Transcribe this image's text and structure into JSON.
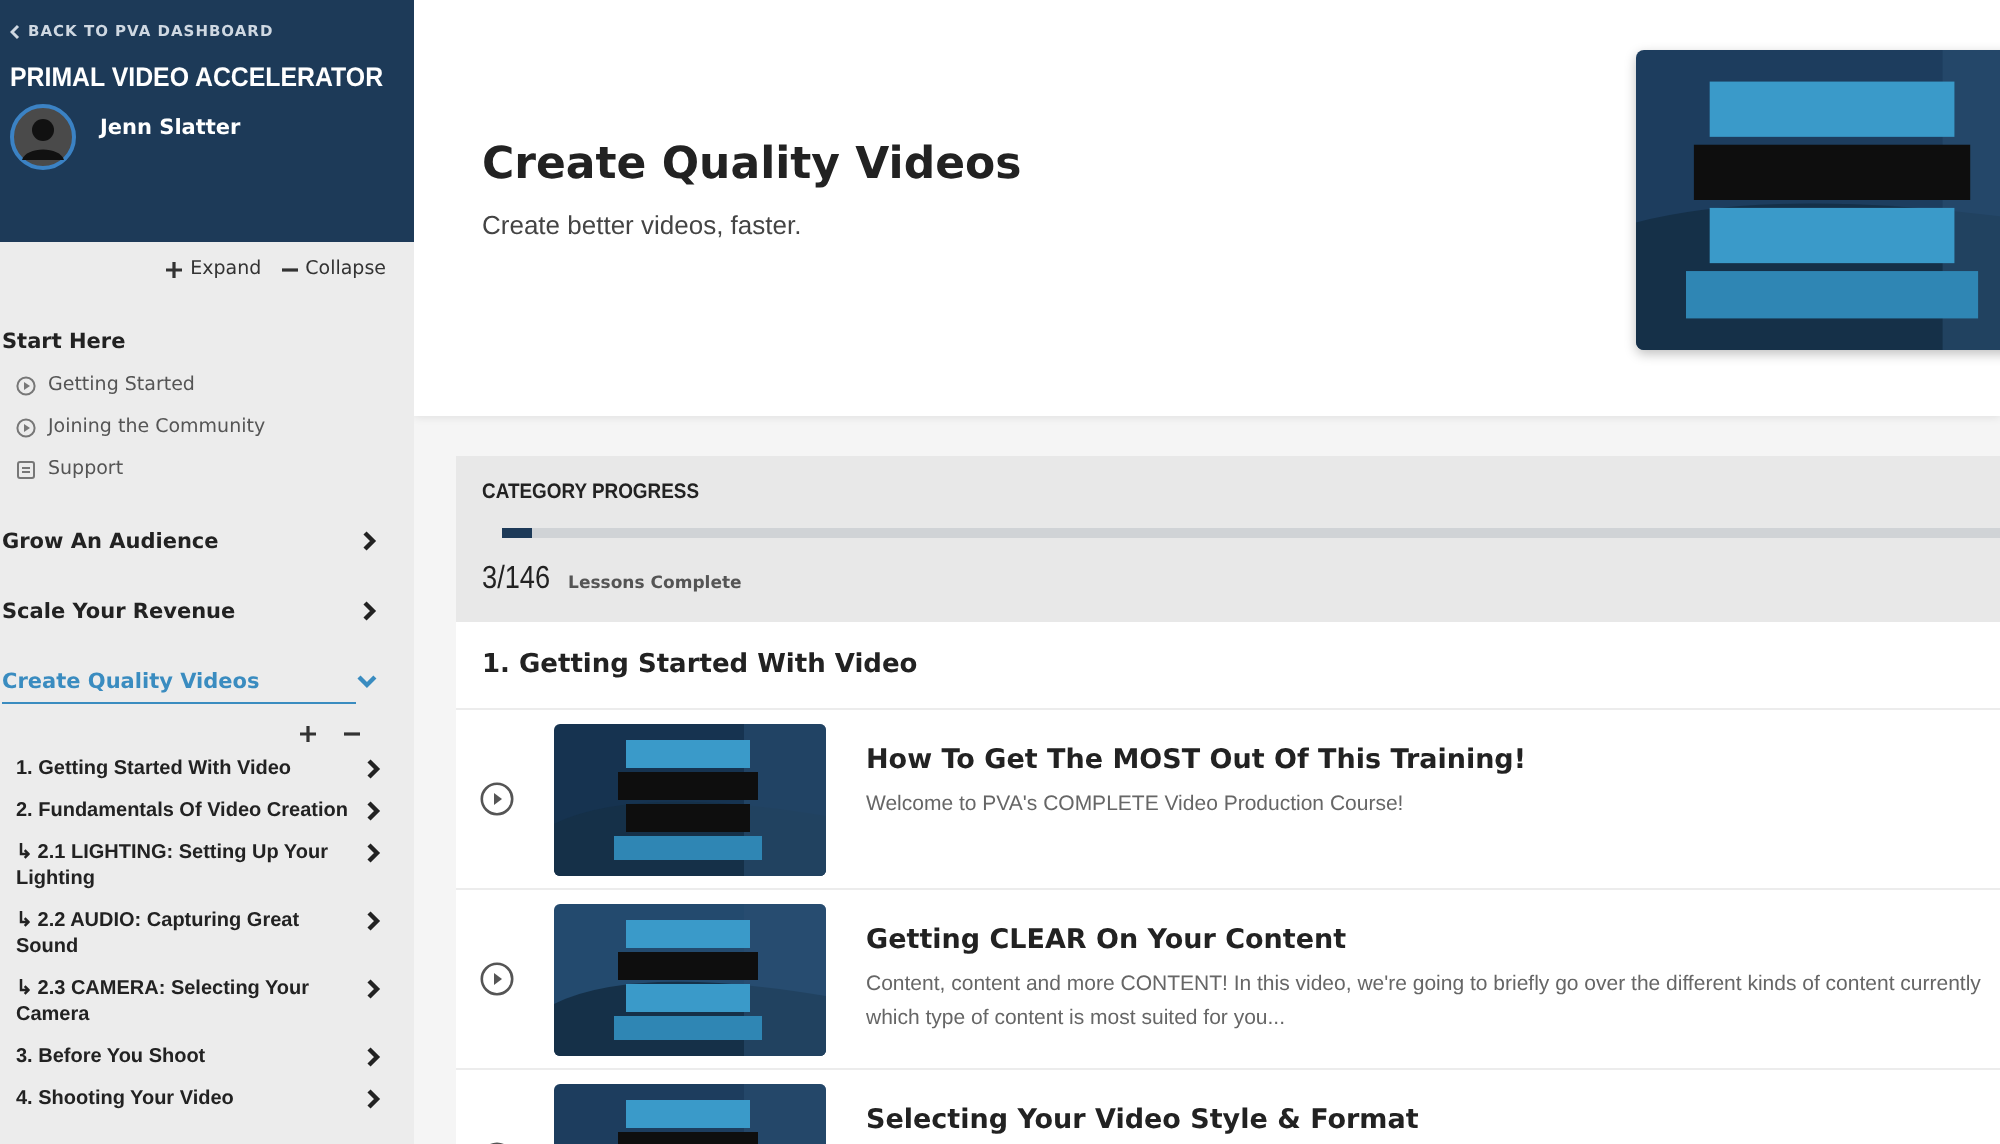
{
  "sidebar": {
    "back_link": "BACK TO PVA DASHBOARD",
    "course_title": "PRIMAL VIDEO ACCELERATOR",
    "user": {
      "name": "Jenn Slatter"
    },
    "expand": "Expand",
    "collapse": "Collapse",
    "sections": [
      {
        "title": "Start Here",
        "kind": "plain",
        "items": [
          {
            "label": "Getting Started",
            "kind": "video"
          },
          {
            "label": "Joining the Community",
            "kind": "video"
          },
          {
            "label": "Support",
            "kind": "page"
          }
        ]
      },
      {
        "title": "Grow An Audience",
        "kind": "collapsible",
        "expanded": false,
        "selected": false
      },
      {
        "title": "Scale Your Revenue",
        "kind": "collapsible",
        "expanded": false,
        "selected": false
      },
      {
        "title": "Create Quality Videos",
        "kind": "collapsible",
        "expanded": true,
        "selected": true,
        "lessons": [
          {
            "label": "1. Getting Started With Video"
          },
          {
            "label": "2. Fundamentals Of Video Creation"
          },
          {
            "label": "↳ 2.1 LIGHTING: Setting Up Your Lighting"
          },
          {
            "label": "↳ 2.2 AUDIO: Capturing Great Sound"
          },
          {
            "label": "↳ 2.3 CAMERA: Selecting Your Camera"
          },
          {
            "label": "3. Before You Shoot"
          },
          {
            "label": "4. Shooting Your Video"
          }
        ]
      }
    ]
  },
  "hero": {
    "title": "Create Quality Videos",
    "subtitle": "Create better videos, faster."
  },
  "progress": {
    "heading": "CATEGORY PROGRESS",
    "level": 0.02,
    "count": "3/146",
    "label": "Lessons Complete"
  },
  "module": {
    "title": "1. Getting Started With Video",
    "lessons": [
      {
        "title": "How To Get The MOST Out Of This Training!",
        "description_lines": [
          "Welcome to PVA's COMPLETE Video Production Course!"
        ]
      },
      {
        "title": "Getting CLEAR On Your Content",
        "description_lines": [
          "Content, content and more CONTENT! In this video, we're going to briefly go over the different kinds of content currently",
          "which type of content is most suited for you..."
        ]
      },
      {
        "title": "Selecting Your Video Style & Format"
      }
    ]
  }
}
